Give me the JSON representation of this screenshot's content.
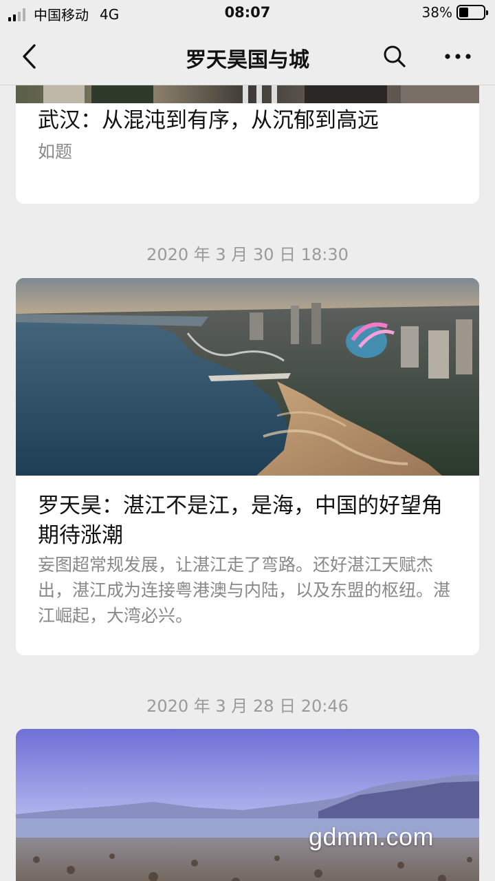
{
  "status_bar": {
    "carrier": "中国移动",
    "network": "4G",
    "time": "08:07",
    "battery_percent": "38%",
    "battery_level": 0.38
  },
  "nav": {
    "title": "罗天昊国与城",
    "back_icon": "chevron-left-icon",
    "search_icon": "search-icon",
    "more_icon": "more-dots-icon"
  },
  "articles": [
    {
      "title": "武汉：从混沌到有序，从沉郁到高远",
      "description": "如题"
    },
    {
      "date": "2020 年 3 月 30 日 18:30",
      "title": "罗天昊：湛江不是江，是海，中国的好望角期待涨潮",
      "description": "妄图超常规发展，让湛江走了弯路。还好湛江天赋杰出，湛江成为连接粤港澳与内陆，以及东盟的枢纽。湛江崛起，大湾必兴。"
    },
    {
      "date": "2020 年 3 月 28 日 20:46",
      "watermark": "gdmm.com"
    }
  ]
}
